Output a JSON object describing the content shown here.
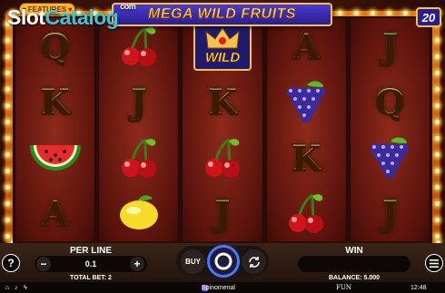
{
  "header": {
    "watermark_slot": "Slot",
    "watermark_catalog": "Catalog",
    "watermark_com": "com",
    "features_label": "FEATURES",
    "game_title": "MEGA WILD FRUITS",
    "active_lines": "20"
  },
  "reels": [
    [
      "Q",
      "K",
      "watermelon",
      "A"
    ],
    [
      "cherries",
      "J",
      "cherries",
      "lemon"
    ],
    [
      "wild",
      "K",
      "cherries",
      "J"
    ],
    [
      "A",
      "grapes",
      "K",
      "cherries"
    ],
    [
      "J",
      "Q",
      "grapes",
      "J"
    ]
  ],
  "symbols": {
    "Q": {
      "text": "Q",
      "style": "gold"
    },
    "K": {
      "text": "K",
      "style": "orange"
    },
    "A": {
      "text": "A",
      "style": "red"
    },
    "J": {
      "text": "J",
      "style": "green"
    },
    "wild_label": "WILD"
  },
  "controls": {
    "help_label": "?",
    "per_line_label": "PER LINE",
    "per_line_value": "0.1",
    "minus_label": "−",
    "plus_label": "+",
    "total_bet_label": "TOTAL BET: 2",
    "buy_label": "BUY",
    "win_label": "WIN",
    "win_value": "",
    "balance_label": "BALANCE: 5.000",
    "currency": "FUN",
    "clock": "12:48",
    "provider": "Spinomenal"
  },
  "colors": {
    "banner": "#2a1d8e",
    "gold": "#f4c24a",
    "reel_bg": "#5a130c",
    "spin_ring": "#4a78ff"
  }
}
